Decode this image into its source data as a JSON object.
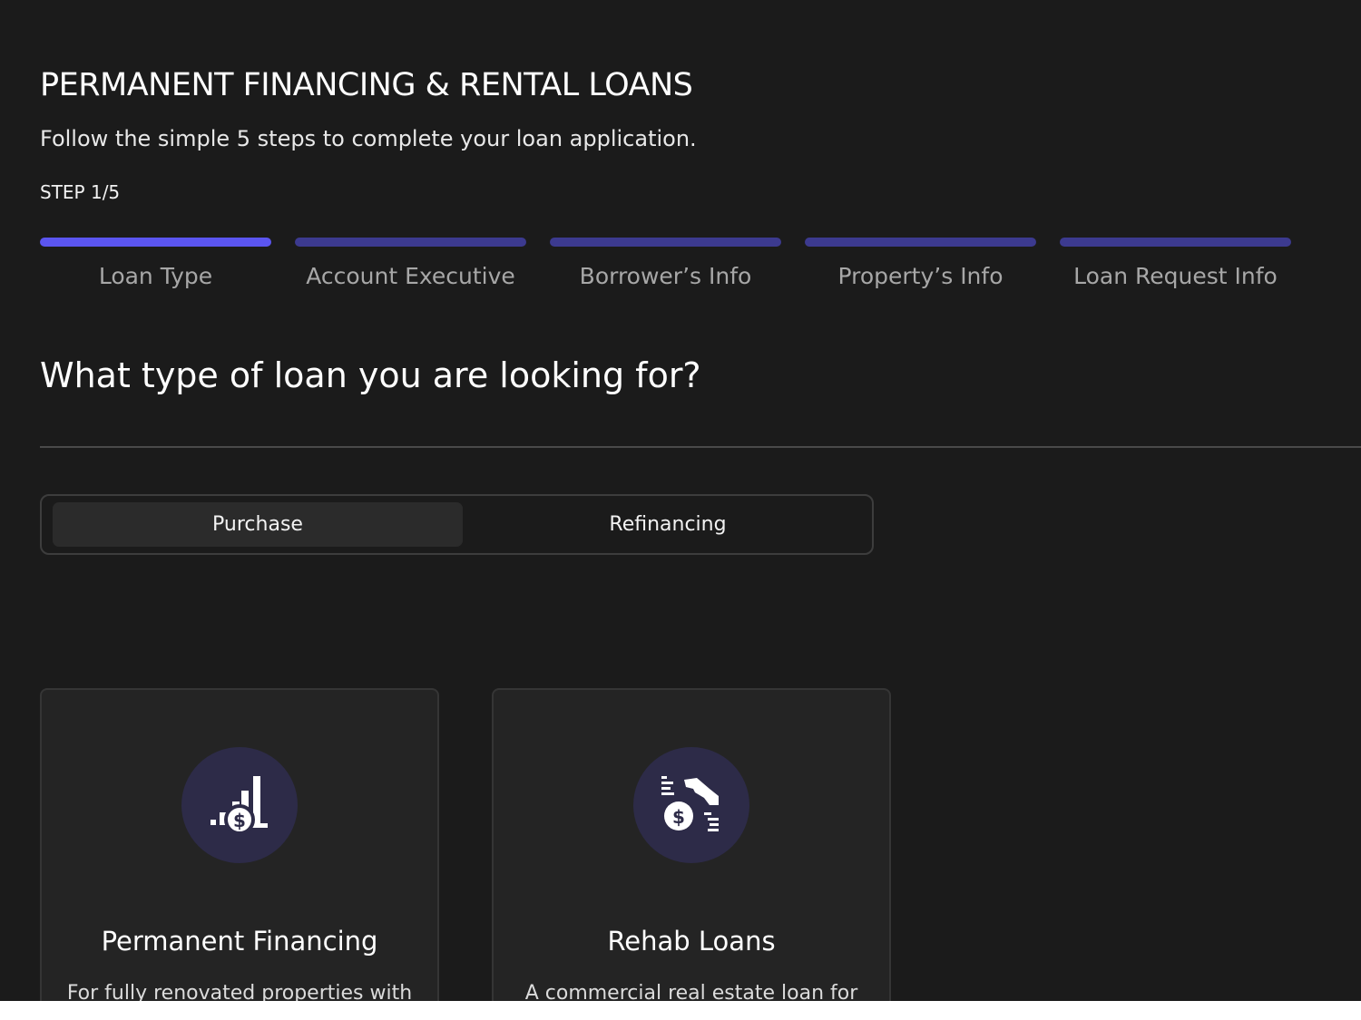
{
  "header": {
    "title": "PERMANENT FINANCING & RENTAL LOANS",
    "subtitle": "Follow the simple 5 steps to complete your loan application.",
    "step_indicator": "STEP 1/5"
  },
  "stepper": {
    "active_index": 0,
    "steps": [
      {
        "label": "Loan Type",
        "active": true
      },
      {
        "label": "Account Executive",
        "active": false
      },
      {
        "label": "Borrower’s Info",
        "active": false
      },
      {
        "label": "Property’s Info",
        "active": false
      },
      {
        "label": "Loan Request Info",
        "active": false
      }
    ]
  },
  "question": "What type of loan you are looking for?",
  "toggle": {
    "selected": "Purchase",
    "options": [
      "Purchase",
      "Refinancing"
    ]
  },
  "cards": [
    {
      "title": "Permanent Financing",
      "description": "For fully renovated properties with",
      "icon": "chart-dollar-icon"
    },
    {
      "title": "Rehab Loans",
      "description": "A commercial real estate loan for",
      "icon": "hand-dollar-icon"
    }
  ],
  "colors": {
    "background": "#1b1b1b",
    "accent_active": "#5b55f0",
    "accent_inactive": "#3c3a8f",
    "card_background": "#242424",
    "icon_circle": "#2d2b48"
  }
}
